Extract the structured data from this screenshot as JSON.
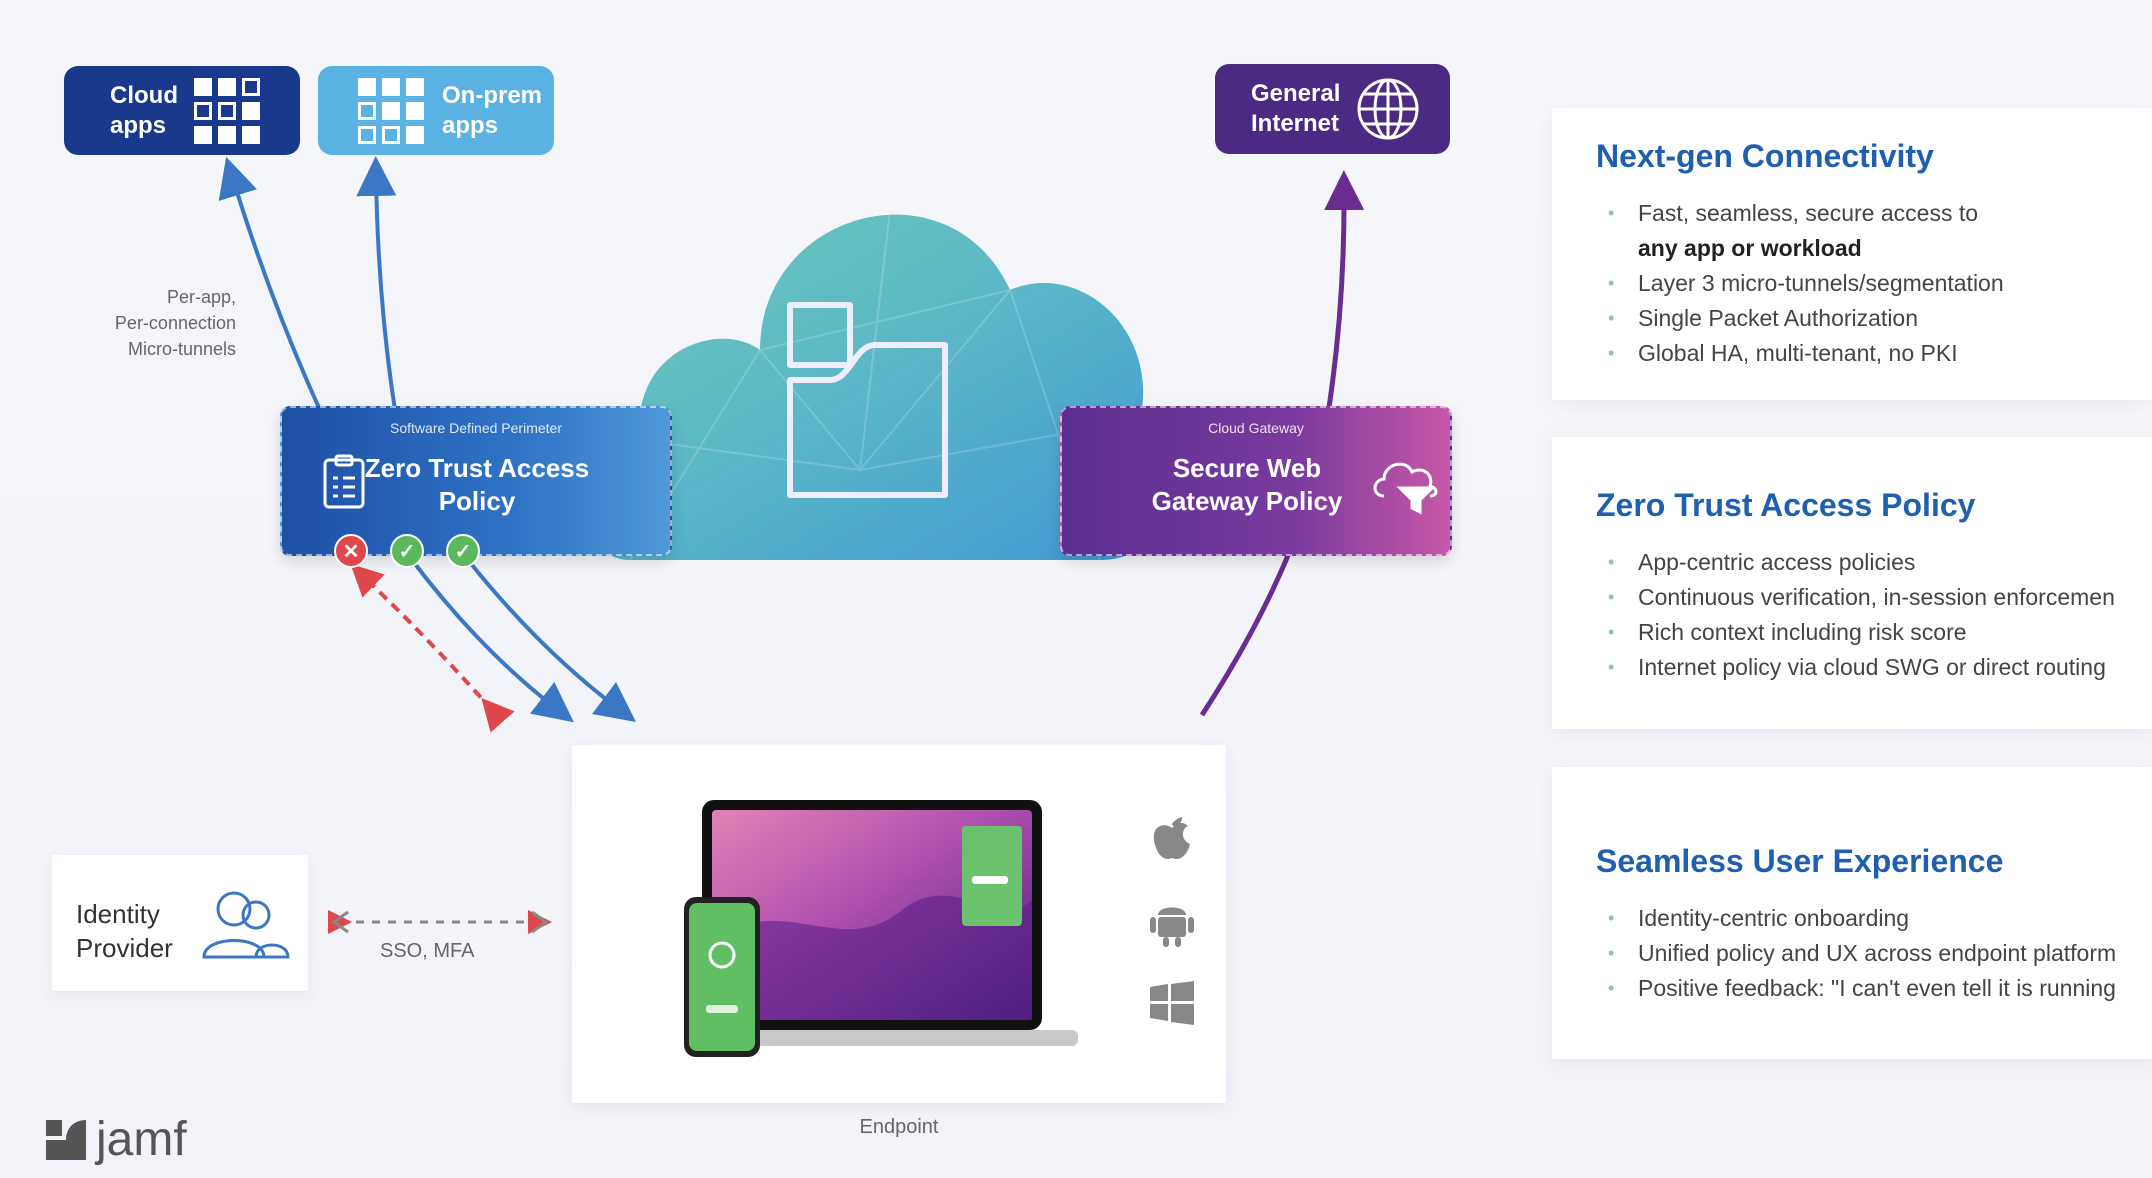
{
  "apps": {
    "cloud": [
      "Cloud",
      "apps"
    ],
    "onprem": [
      "On-prem",
      "apps"
    ],
    "internet": [
      "General",
      "Internet"
    ]
  },
  "tunnels_label": [
    "Per-app,",
    "Per-connection",
    "Micro-tunnels"
  ],
  "zt_policy": {
    "subtitle": "Software Defined Perimeter",
    "title": "Zero Trust Access Policy"
  },
  "swg_policy": {
    "subtitle": "Cloud Gateway",
    "title": "Secure Web Gateway Policy"
  },
  "identity": {
    "label_line1": "Identity",
    "label_line2": "Provider"
  },
  "sso_label": "SSO, MFA",
  "endpoint_label": "Endpoint",
  "panels": [
    {
      "title": "Next-gen Connectivity",
      "items": [
        "Fast, seamless, secure access to",
        "any app or workload",
        "Layer 3 micro-tunnels/segmentation",
        "Single Packet Authorization",
        "Global HA, multi-tenant, no PKI"
      ]
    },
    {
      "title": "Zero Trust Access Policy",
      "items": [
        "App-centric access policies",
        "Continuous verification, in-session enforcemen",
        "Rich context including risk score",
        "Internet policy via cloud SWG or direct routing"
      ]
    },
    {
      "title": "Seamless User Experience",
      "items": [
        "Identity-centric onboarding",
        "Unified policy and UX across endpoint platform",
        "Positive feedback: \"I can't even tell it is running"
      ]
    }
  ],
  "brand": "jamf",
  "colors": {
    "blue_arrow": "#3b78c4",
    "purple_arrow": "#6a2d8f",
    "red_arrow": "#e0474c",
    "green_check": "#5cb85c",
    "heading_blue": "#1f5fb0"
  }
}
